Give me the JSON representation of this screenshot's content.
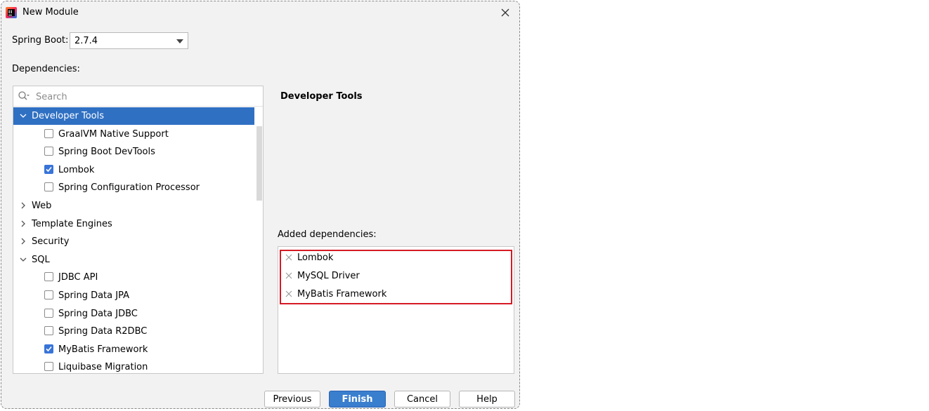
{
  "window": {
    "title": "New Module",
    "icon": "intellij-idea-icon"
  },
  "spring_boot": {
    "label": "Spring Boot:",
    "value": "2.7.4"
  },
  "dependencies": {
    "label": "Dependencies:",
    "search_placeholder": "Search",
    "tree": [
      {
        "type": "group",
        "label": "Developer Tools",
        "expanded": true,
        "selected": true
      },
      {
        "type": "item",
        "label": "GraalVM Native Support",
        "checked": false
      },
      {
        "type": "item",
        "label": "Spring Boot DevTools",
        "checked": false
      },
      {
        "type": "item",
        "label": "Lombok",
        "checked": true
      },
      {
        "type": "item",
        "label": "Spring Configuration Processor",
        "checked": false
      },
      {
        "type": "group",
        "label": "Web",
        "expanded": false
      },
      {
        "type": "group",
        "label": "Template Engines",
        "expanded": false
      },
      {
        "type": "group",
        "label": "Security",
        "expanded": false
      },
      {
        "type": "group",
        "label": "SQL",
        "expanded": true
      },
      {
        "type": "item",
        "label": "JDBC API",
        "checked": false
      },
      {
        "type": "item",
        "label": "Spring Data JPA",
        "checked": false
      },
      {
        "type": "item",
        "label": "Spring Data JDBC",
        "checked": false
      },
      {
        "type": "item",
        "label": "Spring Data R2DBC",
        "checked": false
      },
      {
        "type": "item",
        "label": "MyBatis Framework",
        "checked": true
      },
      {
        "type": "item",
        "label": "Liquibase Migration",
        "checked": false
      }
    ]
  },
  "detail": {
    "title": "Developer Tools"
  },
  "added": {
    "label": "Added dependencies:",
    "items": [
      "Lombok",
      "MySQL Driver",
      "MyBatis Framework"
    ]
  },
  "buttons": {
    "previous": "Previous",
    "finish": "Finish",
    "cancel": "Cancel",
    "help": "Help"
  },
  "colors": {
    "selection": "#2f70c3",
    "checkbox_checked": "#3874d8",
    "highlight": "#d51a23",
    "primary_button": "#3a7ece"
  }
}
